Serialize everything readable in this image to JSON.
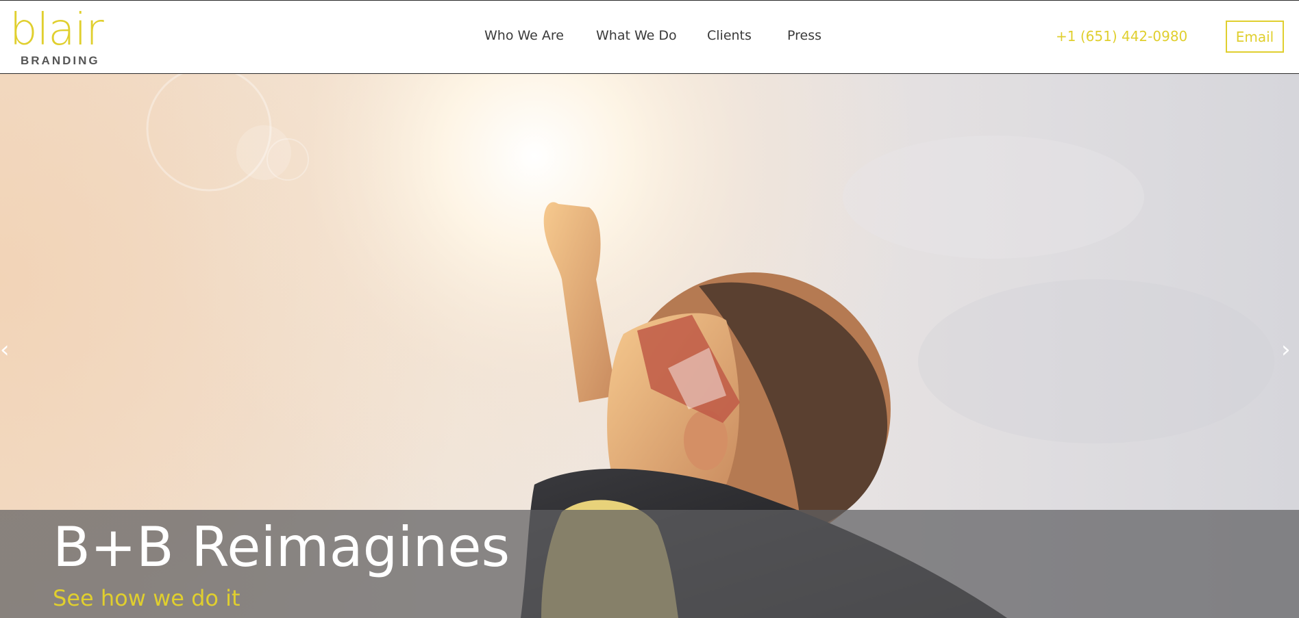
{
  "brand": {
    "logo_word": "blair",
    "logo_sub": "BRANDING",
    "accent_color": "#e0cf2e"
  },
  "nav": {
    "items": [
      {
        "label": "Who We Are"
      },
      {
        "label": "What We Do"
      },
      {
        "label": "Clients"
      },
      {
        "label": "Press"
      }
    ]
  },
  "contact": {
    "phone": "+1 (651) 442-0980",
    "email_label": "Email"
  },
  "hero": {
    "title": "B+B Reimagines",
    "link_label": "See how we do it",
    "prev_icon": "chevron-left-icon",
    "next_icon": "chevron-right-icon",
    "prev_glyph": "‹",
    "next_glyph": "›"
  }
}
